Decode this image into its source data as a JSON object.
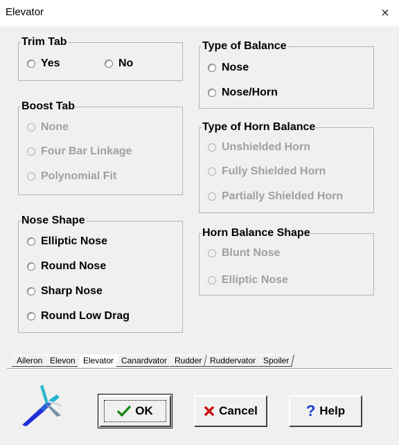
{
  "window": {
    "title": "Elevator",
    "close_icon": "×"
  },
  "groups": {
    "trim_tab": {
      "title": "Trim Tab",
      "options": [
        {
          "label": "Yes",
          "enabled": true,
          "selected": false
        },
        {
          "label": "No",
          "enabled": true,
          "selected": false
        }
      ]
    },
    "boost_tab": {
      "title": "Boost Tab",
      "options": [
        {
          "label": "None",
          "enabled": false
        },
        {
          "label": "Four Bar Linkage",
          "enabled": false
        },
        {
          "label": "Polynomial Fit",
          "enabled": false
        }
      ]
    },
    "nose_shape": {
      "title": "Nose Shape",
      "options": [
        {
          "label": "Elliptic Nose",
          "enabled": true
        },
        {
          "label": "Round Nose",
          "enabled": true
        },
        {
          "label": "Sharp Nose",
          "enabled": true
        },
        {
          "label": "Round Low Drag",
          "enabled": true
        }
      ]
    },
    "type_of_balance": {
      "title": "Type of Balance",
      "options": [
        {
          "label": "Nose",
          "enabled": true
        },
        {
          "label": "Nose/Horn",
          "enabled": true
        }
      ]
    },
    "type_of_horn_balance": {
      "title": "Type of Horn Balance",
      "options": [
        {
          "label": "Unshielded Horn",
          "enabled": false
        },
        {
          "label": "Fully Shielded Horn",
          "enabled": false
        },
        {
          "label": "Partially Shielded Horn",
          "enabled": false
        }
      ]
    },
    "horn_balance_shape": {
      "title": "Horn Balance Shape",
      "options": [
        {
          "label": "Blunt Nose",
          "enabled": false
        },
        {
          "label": "Elliptic Nose",
          "enabled": false
        }
      ]
    }
  },
  "tabs": [
    {
      "label": "Aileron",
      "active": false
    },
    {
      "label": "Elevon",
      "active": false
    },
    {
      "label": "Elevator",
      "active": true
    },
    {
      "label": "Canardvator",
      "active": false
    },
    {
      "label": "Rudder",
      "active": false
    },
    {
      "label": "Ruddervator",
      "active": false
    },
    {
      "label": "Spoiler",
      "active": false
    }
  ],
  "buttons": {
    "ok": {
      "label": "OK",
      "icon": "check-icon",
      "icon_color": "#1a8a1a"
    },
    "cancel": {
      "label": "Cancel",
      "icon": "x-mark-icon",
      "icon_color": "#cc1111"
    },
    "help": {
      "label": "Help",
      "icon": "question-icon",
      "icon_color": "#1a3ccc"
    }
  },
  "colors": {
    "background": "#f0f0f0",
    "disabled_text": "#a0a0a0",
    "group_border": "#b4b4b4"
  }
}
